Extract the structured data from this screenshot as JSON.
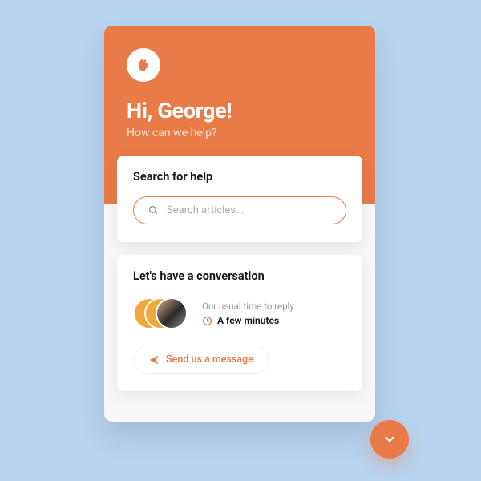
{
  "header": {
    "greeting": "Hi, George!",
    "subtitle": "How can we help?"
  },
  "search": {
    "title": "Search for help",
    "placeholder": "Search articles..."
  },
  "conversation": {
    "title": "Let's have a conversation",
    "reply_label": "Our usual time to reply",
    "reply_time": "A few minutes",
    "send_label": "Send us a message"
  },
  "colors": {
    "accent": "#e87b47",
    "background": "#b8d4f0"
  }
}
